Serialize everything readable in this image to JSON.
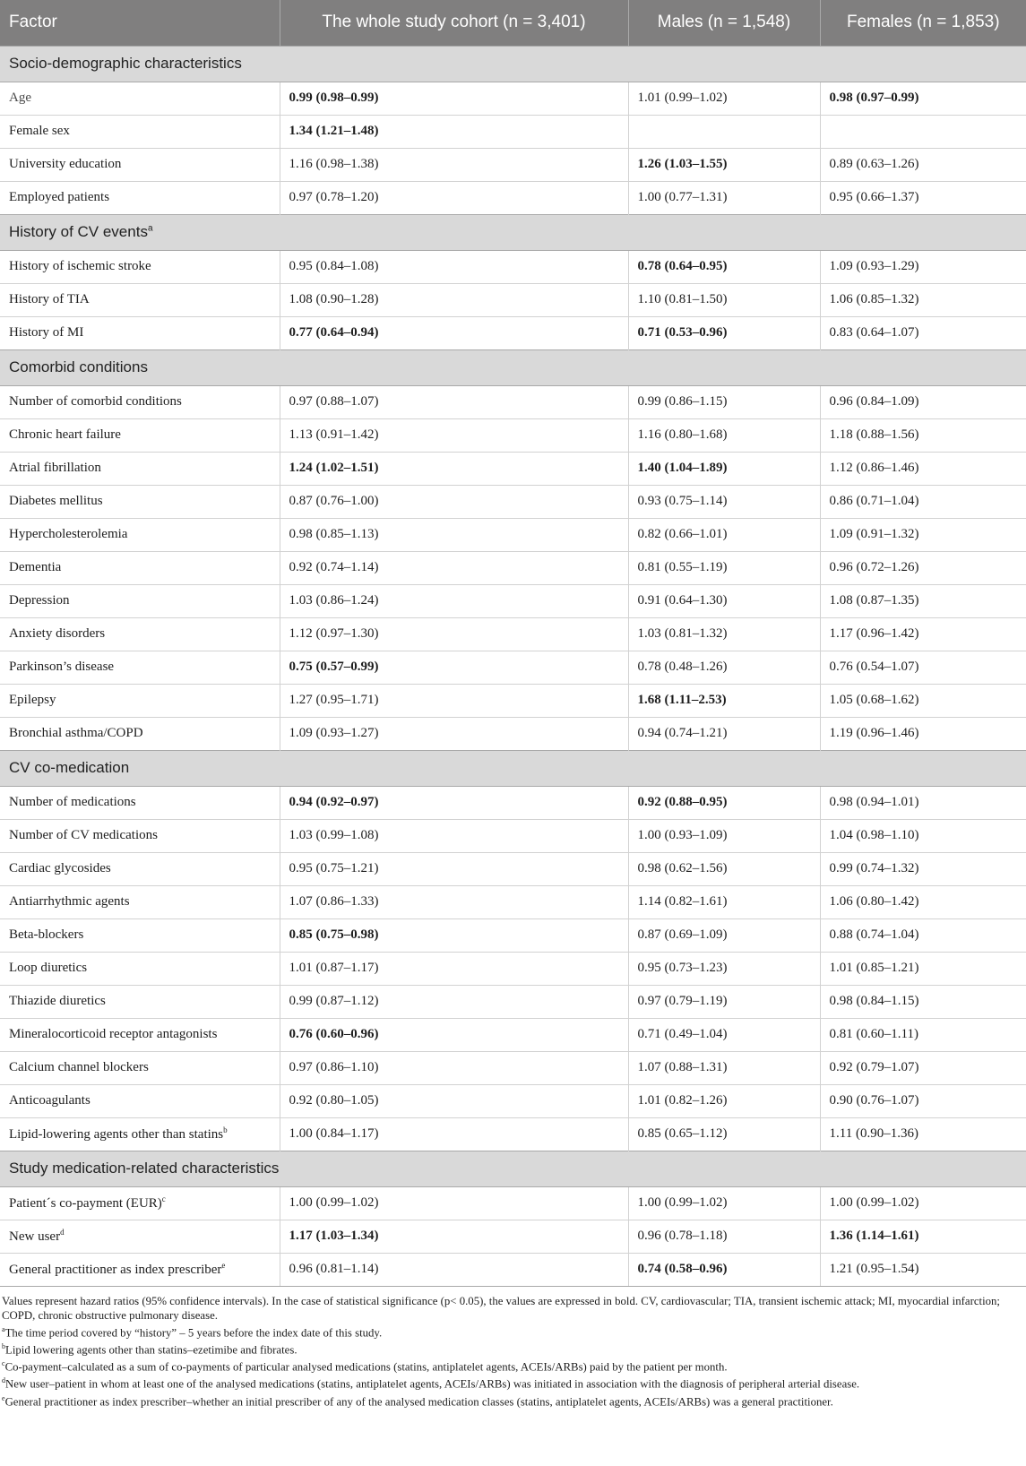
{
  "header": {
    "factor": "Factor",
    "whole": "The whole study cohort (n = 3,401)",
    "males": "Males (n = 1,548)",
    "females": "Females (n = 1,853)"
  },
  "sections": [
    {
      "title": "Socio-demographic characteristics",
      "title_sup": "",
      "rows": [
        {
          "label": "Age",
          "sup": "",
          "whole": "0.99 (0.98–0.99)",
          "whole_bold": true,
          "males": "1.01 (0.99–1.02)",
          "males_bold": false,
          "females": "0.98 (0.97–0.99)",
          "females_bold": true
        },
        {
          "label": "Female sex",
          "sup": "",
          "whole": "1.34 (1.21–1.48)",
          "whole_bold": true,
          "males": "",
          "males_bold": false,
          "females": "",
          "females_bold": false
        },
        {
          "label": "University education",
          "sup": "",
          "whole": "1.16 (0.98–1.38)",
          "whole_bold": false,
          "males": "1.26 (1.03–1.55)",
          "males_bold": true,
          "females": "0.89 (0.63–1.26)",
          "females_bold": false
        },
        {
          "label": "Employed patients",
          "sup": "",
          "whole": "0.97 (0.78–1.20)",
          "whole_bold": false,
          "males": "1.00 (0.77–1.31)",
          "males_bold": false,
          "females": "0.95 (0.66–1.37)",
          "females_bold": false
        }
      ]
    },
    {
      "title": "History of CV events",
      "title_sup": "a",
      "rows": [
        {
          "label": "History of ischemic stroke",
          "sup": "",
          "whole": "0.95 (0.84–1.08)",
          "whole_bold": false,
          "males": "0.78 (0.64–0.95)",
          "males_bold": true,
          "females": "1.09 (0.93–1.29)",
          "females_bold": false
        },
        {
          "label": "History of TIA",
          "sup": "",
          "whole": "1.08 (0.90–1.28)",
          "whole_bold": false,
          "males": "1.10 (0.81–1.50)",
          "males_bold": false,
          "females": "1.06 (0.85–1.32)",
          "females_bold": false
        },
        {
          "label": "History of MI",
          "sup": "",
          "whole": "0.77 (0.64–0.94)",
          "whole_bold": true,
          "males": "0.71 (0.53–0.96)",
          "males_bold": true,
          "females": "0.83 (0.64–1.07)",
          "females_bold": false
        }
      ]
    },
    {
      "title": "Comorbid conditions",
      "title_sup": "",
      "rows": [
        {
          "label": "Number of comorbid conditions",
          "sup": "",
          "whole": "0.97 (0.88–1.07)",
          "whole_bold": false,
          "males": "0.99 (0.86–1.15)",
          "males_bold": false,
          "females": "0.96 (0.84–1.09)",
          "females_bold": false
        },
        {
          "label": "Chronic heart failure",
          "sup": "",
          "whole": "1.13 (0.91–1.42)",
          "whole_bold": false,
          "males": "1.16 (0.80–1.68)",
          "males_bold": false,
          "females": "1.18 (0.88–1.56)",
          "females_bold": false
        },
        {
          "label": "Atrial fibrillation",
          "sup": "",
          "whole": "1.24 (1.02–1.51)",
          "whole_bold": true,
          "males": "1.40 (1.04–1.89)",
          "males_bold": true,
          "females": "1.12 (0.86–1.46)",
          "females_bold": false
        },
        {
          "label": "Diabetes mellitus",
          "sup": "",
          "whole": "0.87 (0.76–1.00)",
          "whole_bold": false,
          "males": "0.93 (0.75–1.14)",
          "males_bold": false,
          "females": "0.86 (0.71–1.04)",
          "females_bold": false
        },
        {
          "label": "Hypercholesterolemia",
          "sup": "",
          "whole": "0.98 (0.85–1.13)",
          "whole_bold": false,
          "males": "0.82 (0.66–1.01)",
          "males_bold": false,
          "females": "1.09 (0.91–1.32)",
          "females_bold": false
        },
        {
          "label": "Dementia",
          "sup": "",
          "whole": "0.92 (0.74–1.14)",
          "whole_bold": false,
          "males": "0.81 (0.55–1.19)",
          "males_bold": false,
          "females": "0.96 (0.72–1.26)",
          "females_bold": false
        },
        {
          "label": "Depression",
          "sup": "",
          "whole": "1.03 (0.86–1.24)",
          "whole_bold": false,
          "males": "0.91 (0.64–1.30)",
          "males_bold": false,
          "females": "1.08 (0.87–1.35)",
          "females_bold": false
        },
        {
          "label": "Anxiety disorders",
          "sup": "",
          "whole": "1.12 (0.97–1.30)",
          "whole_bold": false,
          "males": "1.03 (0.81–1.32)",
          "males_bold": false,
          "females": "1.17 (0.96–1.42)",
          "females_bold": false
        },
        {
          "label": "Parkinson’s disease",
          "sup": "",
          "whole": "0.75 (0.57–0.99)",
          "whole_bold": true,
          "males": "0.78 (0.48–1.26)",
          "males_bold": false,
          "females": "0.76 (0.54–1.07)",
          "females_bold": false
        },
        {
          "label": "Epilepsy",
          "sup": "",
          "whole": "1.27 (0.95–1.71)",
          "whole_bold": false,
          "males": "1.68 (1.11–2.53)",
          "males_bold": true,
          "females": "1.05 (0.68–1.62)",
          "females_bold": false
        },
        {
          "label": "Bronchial asthma/COPD",
          "sup": "",
          "whole": "1.09 (0.93–1.27)",
          "whole_bold": false,
          "males": "0.94 (0.74–1.21)",
          "males_bold": false,
          "females": "1.19 (0.96–1.46)",
          "females_bold": false
        }
      ]
    },
    {
      "title": "CV co-medication",
      "title_sup": "",
      "rows": [
        {
          "label": "Number of medications",
          "sup": "",
          "whole": "0.94 (0.92–0.97)",
          "whole_bold": true,
          "males": "0.92 (0.88–0.95)",
          "males_bold": true,
          "females": "0.98 (0.94–1.01)",
          "females_bold": false
        },
        {
          "label": "Number of CV medications",
          "sup": "",
          "whole": "1.03 (0.99–1.08)",
          "whole_bold": false,
          "males": "1.00 (0.93–1.09)",
          "males_bold": false,
          "females": "1.04 (0.98–1.10)",
          "females_bold": false
        },
        {
          "label": "Cardiac glycosides",
          "sup": "",
          "whole": "0.95 (0.75–1.21)",
          "whole_bold": false,
          "males": "0.98 (0.62–1.56)",
          "males_bold": false,
          "females": "0.99 (0.74–1.32)",
          "females_bold": false
        },
        {
          "label": "Antiarrhythmic agents",
          "sup": "",
          "whole": "1.07 (0.86–1.33)",
          "whole_bold": false,
          "males": "1.14 (0.82–1.61)",
          "males_bold": false,
          "females": "1.06 (0.80–1.42)",
          "females_bold": false
        },
        {
          "label": "Beta-blockers",
          "sup": "",
          "whole": "0.85 (0.75–0.98)",
          "whole_bold": true,
          "males": "0.87 (0.69–1.09)",
          "males_bold": false,
          "females": "0.88 (0.74–1.04)",
          "females_bold": false
        },
        {
          "label": "Loop diuretics",
          "sup": "",
          "whole": "1.01 (0.87–1.17)",
          "whole_bold": false,
          "males": "0.95 (0.73–1.23)",
          "males_bold": false,
          "females": "1.01 (0.85–1.21)",
          "females_bold": false
        },
        {
          "label": "Thiazide diuretics",
          "sup": "",
          "whole": "0.99 (0.87–1.12)",
          "whole_bold": false,
          "males": "0.97 (0.79–1.19)",
          "males_bold": false,
          "females": "0.98 (0.84–1.15)",
          "females_bold": false
        },
        {
          "label": "Mineralocorticoid receptor antagonists",
          "sup": "",
          "whole": "0.76 (0.60–0.96)",
          "whole_bold": true,
          "males": "0.71 (0.49–1.04)",
          "males_bold": false,
          "females": "0.81 (0.60–1.11)",
          "females_bold": false
        },
        {
          "label": "Calcium channel blockers",
          "sup": "",
          "whole": "0.97 (0.86–1.10)",
          "whole_bold": false,
          "males": "1.07 (0.88–1.31)",
          "males_bold": false,
          "females": "0.92 (0.79–1.07)",
          "females_bold": false
        },
        {
          "label": "Anticoagulants",
          "sup": "",
          "whole": "0.92 (0.80–1.05)",
          "whole_bold": false,
          "males": "1.01 (0.82–1.26)",
          "males_bold": false,
          "females": "0.90 (0.76–1.07)",
          "females_bold": false
        },
        {
          "label": "Lipid-lowering agents other than statins",
          "sup": "b",
          "whole": "1.00 (0.84–1.17)",
          "whole_bold": false,
          "males": "0.85 (0.65–1.12)",
          "males_bold": false,
          "females": "1.11 (0.90–1.36)",
          "females_bold": false
        }
      ]
    },
    {
      "title": "Study medication-related characteristics",
      "title_sup": "",
      "rows": [
        {
          "label": "Patient´s co-payment (EUR)",
          "sup": "c",
          "whole": "1.00 (0.99–1.02)",
          "whole_bold": false,
          "males": "1.00 (0.99–1.02)",
          "males_bold": false,
          "females": "1.00 (0.99–1.02)",
          "females_bold": false
        },
        {
          "label": "New user",
          "sup": "d",
          "whole": "1.17 (1.03–1.34)",
          "whole_bold": true,
          "males": "0.96 (0.78–1.18)",
          "males_bold": false,
          "females": "1.36 (1.14–1.61)",
          "females_bold": true
        },
        {
          "label": "General practitioner as index prescriber",
          "sup": "e",
          "whole": "0.96 (0.81–1.14)",
          "whole_bold": false,
          "males": "0.74 (0.58–0.96)",
          "males_bold": true,
          "females": "1.21 (0.95–1.54)",
          "females_bold": false
        }
      ]
    }
  ],
  "footnotes": {
    "main": "Values represent hazard ratios (95% confidence intervals). In the case of statistical significance (p< 0.05), the values are expressed in bold. CV, cardiovascular; TIA, transient ischemic attack; MI, myocardial infarction; COPD, chronic obstructive pulmonary disease.",
    "items": [
      {
        "mark": "a",
        "text": "The time period covered by “history” – 5 years before the index date of this study."
      },
      {
        "mark": "b",
        "text": "Lipid lowering agents other than statins–ezetimibe and fibrates."
      },
      {
        "mark": "c",
        "text": "Co-payment–calculated as a sum of co-payments of particular analysed medications (statins, antiplatelet agents, ACEIs/ARBs) paid by the patient per month."
      },
      {
        "mark": "d",
        "text": "New user–patient in whom at least one of the analysed medications (statins, antiplatelet agents, ACEIs/ARBs) was initiated in association with the diagnosis of peripheral arterial disease."
      },
      {
        "mark": "e",
        "text": "General practitioner as index prescriber–whether an initial prescriber of any of the analysed medication classes (statins, antiplatelet agents, ACEIs/ARBs) was a general practitioner."
      }
    ]
  }
}
